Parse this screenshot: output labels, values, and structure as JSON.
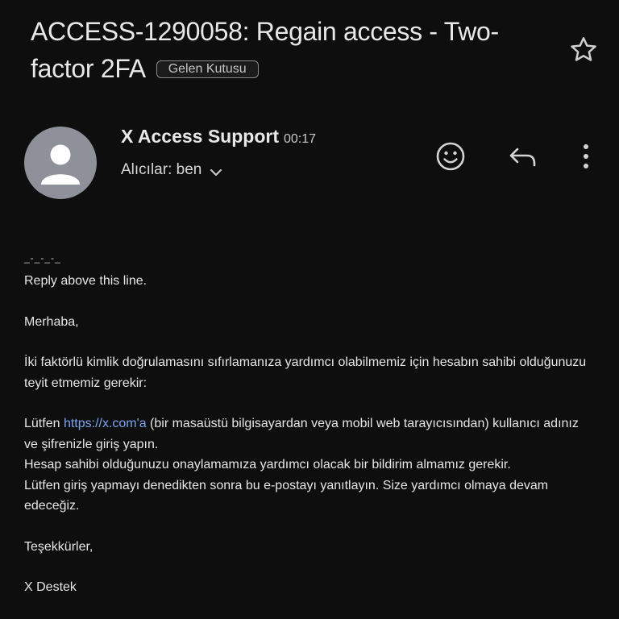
{
  "email": {
    "subject": "ACCESS-1290058: Regain access - Two-factor 2FA",
    "label": "Gelen Kutusu",
    "sender": "X Access Support",
    "time": "00:17",
    "recipients": "Alıcılar: ben",
    "body": {
      "separator": "_-_-_-_",
      "reply_above": "Reply above this line.",
      "greeting": "Merhaba,",
      "paragraph1": "İki faktörlü kimlik doğrulamasını sıfırlamanıza yardımcı olabilmemiz için hesabın sahibi olduğunuzu teyit etmemiz gerekir:",
      "p2_before_link": "Lütfen ",
      "p2_link": "https://x.com'a",
      "p2_after_link": " (bir masaüstü bilgisayardan veya mobil web tarayıcısından) kullanıcı adınız ve şifrenizle giriş yapın.",
      "p2_line2": "Hesap sahibi olduğunuzu onaylamamıza yardımcı olacak bir bildirim almamız gerekir.",
      "p2_line3": "Lütfen giriş yapmayı denedikten sonra bu e-postayı yanıtlayın. Size yardımcı olmaya devam edeceğiz.",
      "thanks": "Teşekkürler,",
      "signature": "X Destek"
    }
  },
  "icons": [
    "star-icon",
    "person-icon",
    "chevron-down-icon",
    "emoji-icon",
    "reply-icon",
    "more-vert-icon"
  ],
  "colors": {
    "background": "#0e0e0e",
    "link": "#7aa5f0",
    "avatar": "#8e9199"
  }
}
